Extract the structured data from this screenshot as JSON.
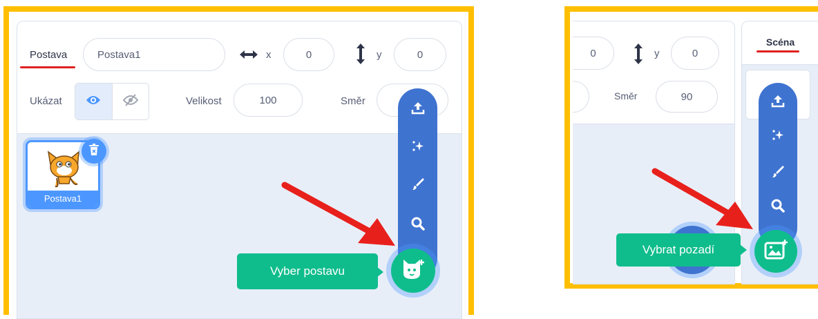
{
  "sprite_panel": {
    "sprite_label": "Postava",
    "sprite_name_value": "Postava1",
    "x_label": "x",
    "x_value": "0",
    "y_label": "y",
    "y_value": "0",
    "show_label": "Ukázat",
    "size_label": "Velikost",
    "size_value": "100",
    "direction_label": "Směr",
    "sprite_tile_name": "Postava1",
    "tooltip": "Vyber postavu",
    "menu_icons": [
      "upload-icon",
      "surprise-icon",
      "paint-icon",
      "search-icon",
      "choose-sprite-icon"
    ]
  },
  "stage_panel": {
    "x_value": "0",
    "y_label": "y",
    "y_value": "0",
    "direction_label": "Směr",
    "direction_value": "90",
    "stage_tab_label": "Scéna",
    "tooltip": "Vybrat pozadí",
    "menu_icons": [
      "upload-icon",
      "surprise-icon",
      "paint-icon",
      "search-icon",
      "choose-backdrop-icon"
    ]
  },
  "colors": {
    "highlight_border": "#FFBF00",
    "menu_blue": "#3F73D0",
    "fab_green": "#0FBD8C",
    "arrow_red": "#E8201C",
    "underline_red": "#E0201E",
    "sprite_blue": "#4C97FF"
  }
}
